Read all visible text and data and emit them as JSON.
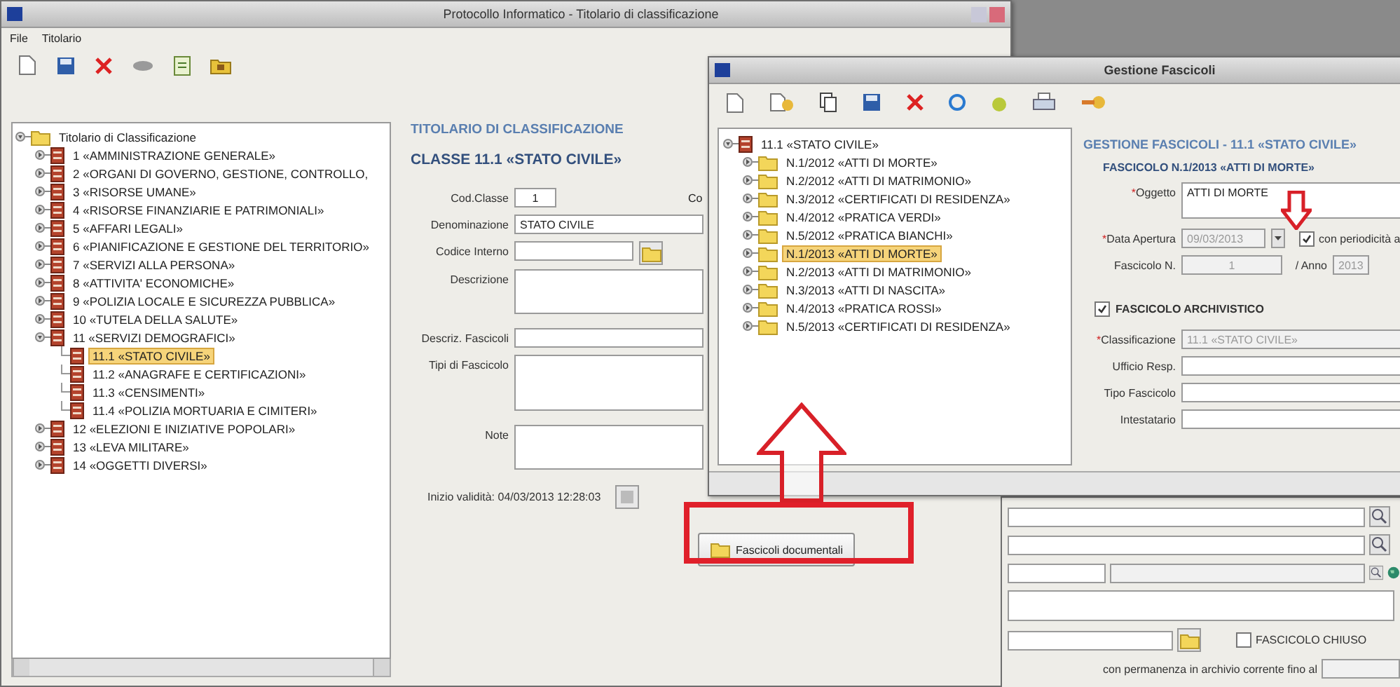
{
  "main_window": {
    "title": "Protocollo Informatico - Titolario di classificazione",
    "menu": [
      "File",
      "Titolario"
    ],
    "tree": {
      "label": "Titolario di Classificazione",
      "kind": "branch",
      "expanded": true,
      "selected": false,
      "children": [
        {
          "label": "1 «AMMINISTRAZIONE GENERALE»",
          "kind": "branch",
          "expanded": false,
          "selected": false
        },
        {
          "label": "2 «ORGANI DI GOVERNO, GESTIONE, CONTROLLO,",
          "kind": "branch",
          "expanded": false,
          "selected": false
        },
        {
          "label": "3 «RISORSE UMANE»",
          "kind": "branch",
          "expanded": false,
          "selected": false
        },
        {
          "label": "4 «RISORSE FINANZIARIE E PATRIMONIALI»",
          "kind": "branch",
          "expanded": false,
          "selected": false
        },
        {
          "label": "5 «AFFARI LEGALI»",
          "kind": "branch",
          "expanded": false,
          "selected": false
        },
        {
          "label": "6 «PIANIFICAZIONE E GESTIONE DEL TERRITORIO»",
          "kind": "branch",
          "expanded": false,
          "selected": false
        },
        {
          "label": "7 «SERVIZI ALLA PERSONA»",
          "kind": "branch",
          "expanded": false,
          "selected": false
        },
        {
          "label": "8 «ATTIVITA' ECONOMICHE»",
          "kind": "branch",
          "expanded": false,
          "selected": false
        },
        {
          "label": "9 «POLIZIA LOCALE E SICUREZZA PUBBLICA»",
          "kind": "branch",
          "expanded": false,
          "selected": false
        },
        {
          "label": "10 «TUTELA DELLA SALUTE»",
          "kind": "branch",
          "expanded": false,
          "selected": false
        },
        {
          "label": "11 «SERVIZI DEMOGRAFICI»",
          "kind": "branch",
          "expanded": true,
          "selected": false,
          "children": [
            {
              "label": "11.1 «STATO CIVILE»",
              "kind": "leaf",
              "selected": true
            },
            {
              "label": "11.2 «ANAGRAFE E CERTIFICAZIONI»",
              "kind": "leaf",
              "selected": false
            },
            {
              "label": "11.3 «CENSIMENTI»",
              "kind": "leaf",
              "selected": false
            },
            {
              "label": "11.4 «POLIZIA MORTUARIA E CIMITERI»",
              "kind": "leaf",
              "selected": false
            }
          ]
        },
        {
          "label": "12 «ELEZIONI E INIZIATIVE POPOLARI»",
          "kind": "branch",
          "expanded": false,
          "selected": false
        },
        {
          "label": "13 «LEVA MILITARE»",
          "kind": "branch",
          "expanded": false,
          "selected": false
        },
        {
          "label": "14 «OGGETTI DIVERSI»",
          "kind": "branch",
          "expanded": false,
          "selected": false
        }
      ]
    },
    "form": {
      "heading": "TITOLARIO DI CLASSIFICAZIONE",
      "subheading": "CLASSE 11.1 «STATO CIVILE»",
      "side_label": "Co",
      "fields": [
        {
          "label": "Cod.Classe",
          "value": "1",
          "kind": "short"
        },
        {
          "label": "Denominazione",
          "value": "STATO CIVILE",
          "kind": "text"
        },
        {
          "label": "Codice Interno",
          "kind": "lookup"
        },
        {
          "label": "Descrizione",
          "kind": "area"
        },
        {
          "label": "Descriz. Fascicoli",
          "kind": "text"
        },
        {
          "label": "Tipi di Fascicolo",
          "kind": "tall"
        },
        {
          "label": "Note",
          "kind": "area"
        }
      ],
      "validity": "Inizio validità: 04/03/2013 12:28:03"
    },
    "button": "Fascicoli documentali"
  },
  "fascicoli_window": {
    "title": "Gestione Fascicoli",
    "tree": {
      "label": "11.1 «STATO CIVILE»",
      "kind": "branch",
      "expanded": true,
      "selected": false,
      "children": [
        {
          "label": "N.1/2012 «ATTI DI MORTE»",
          "kind": "branch",
          "expanded": false,
          "selected": false
        },
        {
          "label": "N.2/2012 «ATTI DI MATRIMONIO»",
          "kind": "branch",
          "expanded": false,
          "selected": false
        },
        {
          "label": "N.3/2012 «CERTIFICATI DI RESIDENZA»",
          "kind": "branch",
          "expanded": false,
          "selected": false
        },
        {
          "label": "N.4/2012 «PRATICA VERDI»",
          "kind": "branch",
          "expanded": false,
          "selected": false
        },
        {
          "label": "N.5/2012 «PRATICA BIANCHI»",
          "kind": "branch",
          "expanded": false,
          "selected": false
        },
        {
          "label": "N.1/2013 «ATTI DI MORTE»",
          "kind": "branch",
          "expanded": false,
          "selected": true
        },
        {
          "label": "N.2/2013 «ATTI DI MATRIMONIO»",
          "kind": "branch",
          "expanded": false,
          "selected": false
        },
        {
          "label": "N.3/2013 «ATTI DI NASCITA»",
          "kind": "branch",
          "expanded": false,
          "selected": false
        },
        {
          "label": "N.4/2013 «PRATICA ROSSI»",
          "kind": "branch",
          "expanded": false,
          "selected": false
        },
        {
          "label": "N.5/2013 «CERTIFICATI DI RESIDENZA»",
          "kind": "branch",
          "expanded": false,
          "selected": false
        }
      ]
    },
    "form": {
      "heading": "GESTIONE FASCICOLI - 11.1 «STATO CIVILE»",
      "subheading": "FASCICOLO N.1/2013 «ATTI DI MORTE»",
      "fields": [
        {
          "kind": "area",
          "mark": "*",
          "label": "Oggetto",
          "value": "ATTI DI MORTE"
        },
        {
          "kind": "date",
          "mark": "*",
          "label": "Data Apertura",
          "value": "09/03/2013",
          "option": {
            "label": "con periodicità a",
            "checked": true
          }
        },
        {
          "kind": "number",
          "label": "Fascicolo N.",
          "value": "1",
          "second_label": "/ Anno",
          "second_value": "2013"
        },
        {
          "kind": "checkbox",
          "label": "FASCICOLO ARCHIVISTICO",
          "checked": true
        },
        {
          "kind": "text",
          "mark": "*",
          "label": "Classificazione",
          "value": "11.1 «STATO CIVILE»",
          "disabled": true
        },
        {
          "kind": "text",
          "label": "Ufficio Resp.",
          "disabled": false
        },
        {
          "kind": "text",
          "label": "Tipo Fascicolo",
          "disabled": false
        },
        {
          "kind": "text",
          "label": "Intestatario",
          "disabled": false
        }
      ]
    }
  },
  "back_panel": {
    "rows": [
      {
        "kind": "search"
      },
      {
        "kind": "search"
      },
      {
        "kind": "code"
      },
      {
        "kind": "wide"
      },
      {
        "kind": "options",
        "checkbox": {
          "label": "FASCICOLO CHIUSO",
          "checked": false
        }
      },
      {
        "kind": "until",
        "label": "con permanenza in archivio corrente fino al"
      }
    ]
  }
}
